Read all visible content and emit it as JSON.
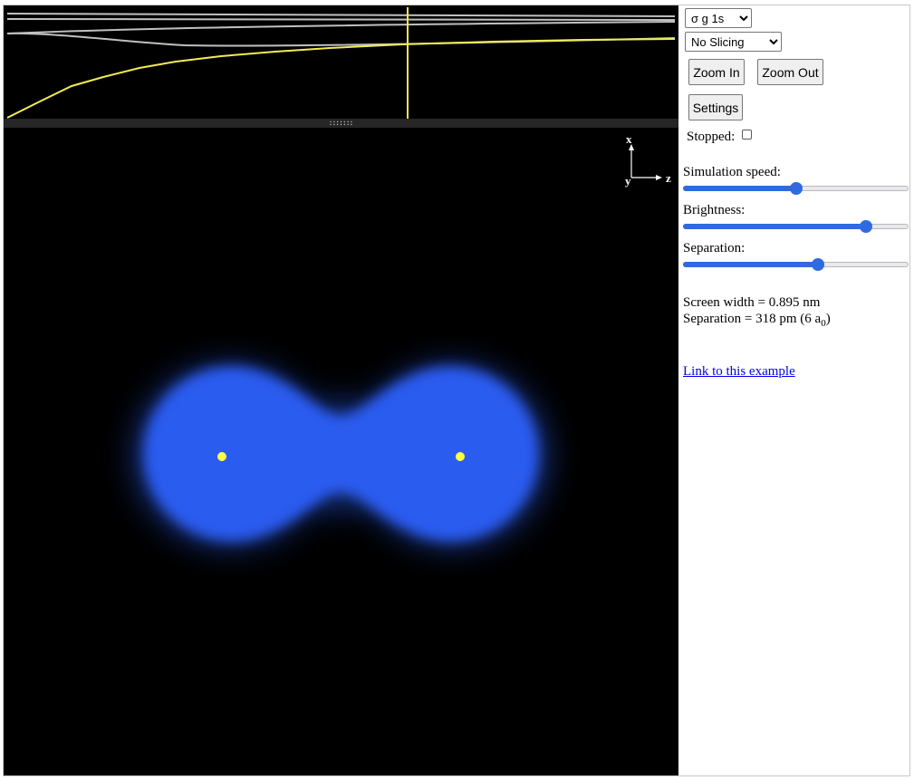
{
  "graph": {
    "gray_line_color": "#c0c0c0",
    "yellow_line_color": "#f2ec52",
    "marker_color": "#f2ec52"
  },
  "splitter": {
    "grip": ":::::::"
  },
  "axes": {
    "x": "x",
    "y": "y",
    "z": "z"
  },
  "simulation": {
    "cloud_color": "#2a5cf0",
    "nucleus_color": "#ffff44"
  },
  "controls": {
    "state_select": {
      "selected": "σ g 1s"
    },
    "slicing_select": {
      "selected": "No Slicing"
    },
    "zoom_in": "Zoom In",
    "zoom_out": "Zoom Out",
    "settings": "Settings",
    "stopped_label": "Stopped:",
    "stopped_checked": false,
    "speed_label": "Simulation speed:",
    "speed_value": 0.5,
    "brightness_label": "Brightness:",
    "brightness_value": 0.81,
    "separation_label": "Separation:",
    "separation_value": 0.6,
    "accent_color": "#2f6bde"
  },
  "info": {
    "screen_width": "Screen width = 0.895 nm",
    "separation_prefix": "Separation = 318 pm (6 a",
    "separation_sub": "0",
    "separation_suffix": ")"
  },
  "link": "Link to this example"
}
